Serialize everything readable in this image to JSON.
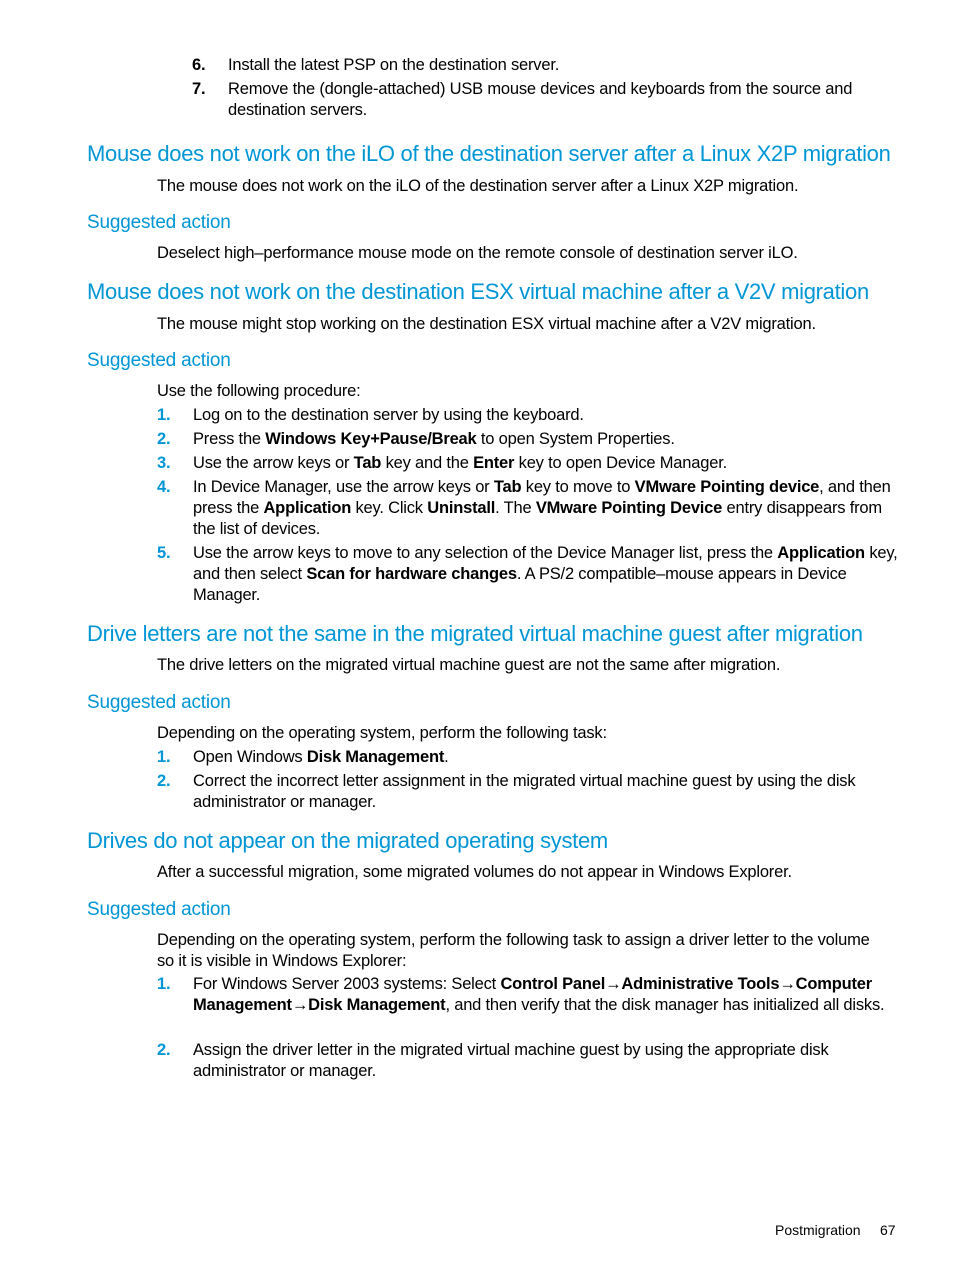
{
  "top_steps": [
    {
      "num": "6.",
      "text": "Install the latest PSP on the destination server."
    },
    {
      "num": "7.",
      "text": "Remove the (dongle-attached) USB mouse devices and keyboards from the source and destination servers."
    }
  ],
  "sections": [
    {
      "heading": "Mouse does not work on the iLO of the destination server after a Linux X2P migration",
      "description": "The mouse does not work on the iLO of the destination server after a Linux X2P migration.",
      "subheading": "Suggested action",
      "action_text": "Deselect high–performance mouse mode on the remote console of destination server iLO."
    },
    {
      "heading": "Mouse does not work on the destination ESX virtual machine after a V2V migration",
      "description": "The mouse might stop working on the destination ESX virtual machine after a V2V migration.",
      "subheading": "Suggested action",
      "action_text": "Use the following procedure:",
      "steps": [
        {
          "num": "1.",
          "parts": [
            "Log on to the destination server by using the keyboard."
          ]
        },
        {
          "num": "2.",
          "parts": [
            "Press the ",
            "Windows Key+Pause/Break",
            " to open System Properties."
          ]
        },
        {
          "num": "3.",
          "parts": [
            "Use the arrow keys or ",
            "Tab",
            " key and the ",
            "Enter",
            " key to open Device Manager."
          ]
        },
        {
          "num": "4.",
          "parts": [
            "In Device Manager, use the arrow keys or ",
            "Tab",
            " key to move to ",
            "VMware Pointing device",
            ", and then press the ",
            "Application",
            " key. Click ",
            "Uninstall",
            ". The ",
            "VMware Pointing Device",
            " entry disappears from the list of devices."
          ]
        },
        {
          "num": "5.",
          "parts": [
            "Use the arrow keys to move to any selection of the Device Manager list, press the ",
            "Application",
            " key, and then select ",
            "Scan for hardware changes",
            ". A PS/2 compatible–mouse appears in Device Manager."
          ]
        }
      ]
    },
    {
      "heading": "Drive letters are not the same in the migrated virtual machine guest after migration",
      "description": "The drive letters on the migrated virtual machine guest are not the same after migration.",
      "subheading": "Suggested action",
      "action_text": "Depending on the operating system, perform the following task:",
      "steps": [
        {
          "num": "1.",
          "parts": [
            "Open Windows ",
            "Disk Management",
            "."
          ]
        },
        {
          "num": "2.",
          "parts": [
            "Correct the incorrect letter assignment in the migrated virtual machine guest by using the disk administrator or manager."
          ]
        }
      ]
    },
    {
      "heading": "Drives do not appear on the migrated operating system",
      "description": "After a successful migration, some migrated volumes do not appear in Windows Explorer.",
      "subheading": "Suggested action",
      "action_text": "Depending on the operating system, perform the following task to assign a driver letter to the volume so it is visible in Windows Explorer:",
      "steps": [
        {
          "num": "1.",
          "parts": [
            "For Windows Server 2003 systems: Select ",
            "Control Panel→Administrative Tools→Computer Management→Disk Management",
            ", and then verify that the disk manager has initialized all disks."
          ]
        },
        {
          "num": "2.",
          "parts": [
            "Assign the driver letter in the migrated virtual machine guest by using the appropriate disk administrator or manager."
          ]
        }
      ]
    }
  ],
  "footer": {
    "section": "Postmigration",
    "page_number": "67"
  },
  "colors": {
    "heading": "#0096d6",
    "text": "#000000"
  }
}
